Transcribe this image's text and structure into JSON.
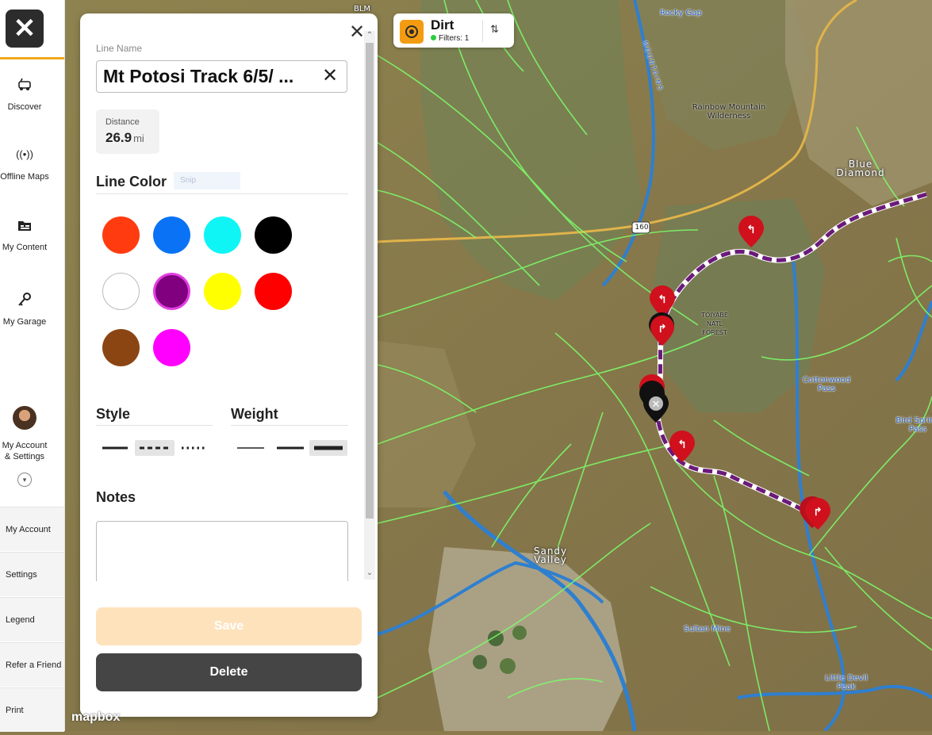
{
  "sidebar": {
    "close_label": "✕",
    "items": [
      {
        "label": "Discover",
        "icon": "jeep-icon"
      },
      {
        "label": "Offline Maps",
        "icon": "broadcast-icon"
      },
      {
        "label": "My Content",
        "icon": "folder-icon"
      },
      {
        "label": "My Garage",
        "icon": "keys-icon"
      },
      {
        "label": "My Account & Settings",
        "icon": "avatar"
      }
    ],
    "links": [
      "My Account",
      "Settings",
      "Legend",
      "Refer a Friend",
      "Print"
    ]
  },
  "panel": {
    "line_name_label": "Line Name",
    "line_name_value": "Mt Potosi Track 6/5/ ...",
    "distance_label": "Distance",
    "distance_value": "26.9",
    "distance_unit": "mi",
    "line_color_title": "Line Color",
    "snip_ghost": "Snip",
    "colors": [
      "#ff3b0f",
      "#0a73f5",
      "#0ff5f5",
      "#000000",
      "#ffffff",
      "#800080",
      "#ffff00",
      "#ff0000",
      "#8b4513",
      "#ff00ff"
    ],
    "selected_color": "#800080",
    "style_title": "Style",
    "weight_title": "Weight",
    "selected_style": "dashed",
    "selected_weight": "thick",
    "notes_title": "Notes",
    "notes_value": "",
    "save_label": "Save",
    "delete_label": "Delete"
  },
  "layer_chip": {
    "name": "Dirt",
    "filters": "Filters: 1"
  },
  "map": {
    "labels": [
      "Rocky Gap",
      "Rainbow Mountain Wilderness",
      "Blue Diamond",
      "TOIYABE NATL FOREST",
      "Cottonwood Pass",
      "Bird Spring Pass",
      "Sandy Valley",
      "Sultan Mine",
      "Little Devil Peak",
      "160",
      "BLM",
      "MOUNTAINS"
    ],
    "attribution": "mapbox"
  }
}
